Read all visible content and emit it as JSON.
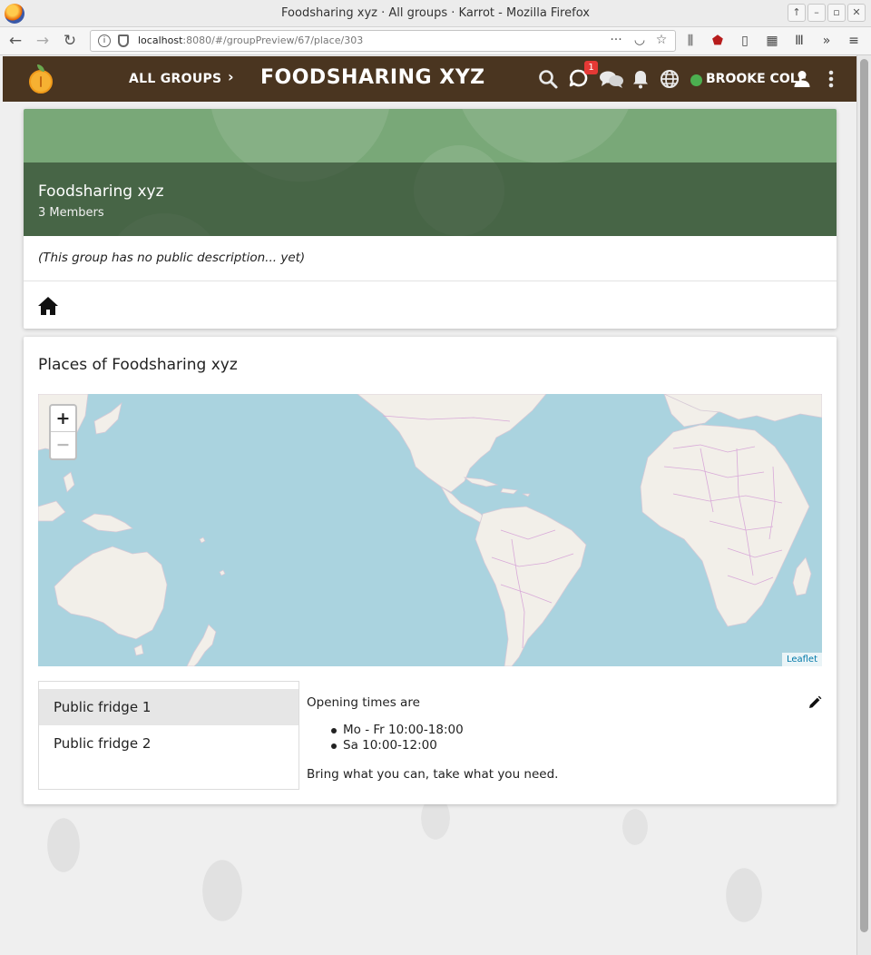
{
  "browser": {
    "window_title": "Foodsharing xyz · All groups · Karrot - Mozilla Firefox",
    "url_host": "localhost",
    "url_rest": ":8080/#/groupPreview/67/place/303"
  },
  "toolbar": {
    "all_groups_label": "ALL GROUPS",
    "group_title": "FOODSHARING XYZ",
    "notification_count": "1",
    "user_name": "BROOKE COLE"
  },
  "group": {
    "name": "Foodsharing xyz",
    "members": "3 Members",
    "description": "(This group has no public description... yet)"
  },
  "places": {
    "title": "Places of Foodsharing xyz",
    "map": {
      "zoom_in": "+",
      "zoom_out": "−",
      "attribution": "Leaflet"
    },
    "items": [
      {
        "label": "Public fridge 1",
        "selected": true
      },
      {
        "label": "Public fridge 2",
        "selected": false
      }
    ],
    "selected": {
      "opening_label": "Opening times are",
      "times": [
        "Mo - Fr 10:00-18:00",
        "Sa 10:00-12:00"
      ],
      "note": "Bring what you can, take what you need."
    }
  },
  "colors": {
    "toolbar": "#4a3520",
    "group_hero": "#79a878",
    "status_online": "#4caf50",
    "badge": "#e53935",
    "map_water": "#aad3df",
    "map_land": "#f2efe9"
  }
}
